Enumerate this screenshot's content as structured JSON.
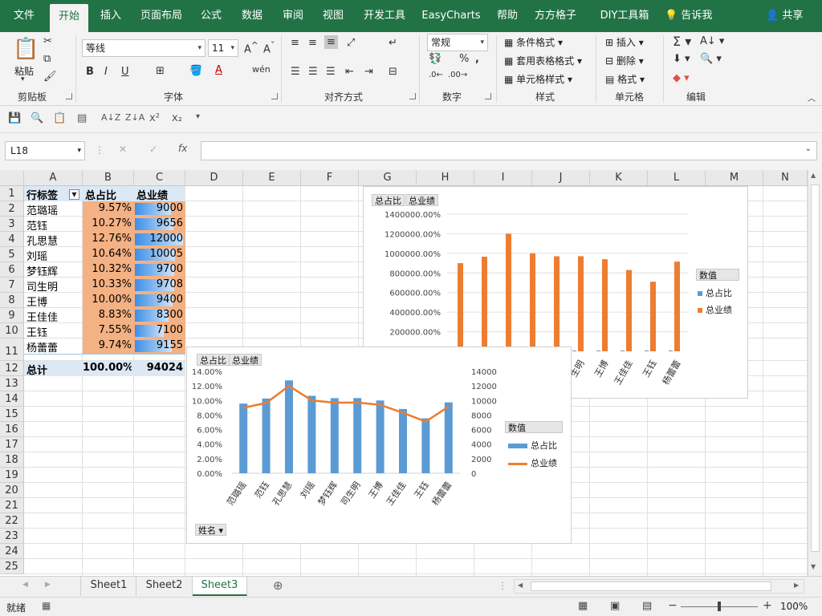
{
  "ribbon": {
    "tabs": [
      "文件",
      "开始",
      "插入",
      "页面布局",
      "公式",
      "数据",
      "审阅",
      "视图",
      "开发工具",
      "EasyCharts",
      "帮助",
      "方方格子",
      "DIY工具箱"
    ],
    "active_tab": "开始",
    "tell_me": "告诉我",
    "share": "共享",
    "clipboard": {
      "paste": "粘贴",
      "label": "剪贴板"
    },
    "font": {
      "name": "等线",
      "size": "11",
      "label": "字体"
    },
    "alignment": {
      "label": "对齐方式"
    },
    "number": {
      "format": "常规",
      "label": "数字"
    },
    "styles": {
      "conditional": "条件格式",
      "table": "套用表格格式",
      "cell": "单元格样式",
      "label": "样式"
    },
    "cells": {
      "insert": "插入",
      "delete": "删除",
      "format": "格式",
      "label": "单元格"
    },
    "editing": {
      "label": "编辑"
    }
  },
  "formula_bar": {
    "name_box": "L18",
    "formula": ""
  },
  "columns": [
    "A",
    "B",
    "C",
    "D",
    "E",
    "F",
    "G",
    "H",
    "I",
    "J",
    "K",
    "L",
    "M",
    "N"
  ],
  "rows": [
    "1",
    "2",
    "3",
    "4",
    "5",
    "6",
    "7",
    "8",
    "9",
    "10",
    "11",
    "12",
    "13",
    "14",
    "15",
    "16",
    "17",
    "18",
    "19",
    "20",
    "21",
    "22",
    "23",
    "24",
    "25"
  ],
  "table": {
    "headers": [
      "行标签",
      "总占比",
      "总业绩"
    ],
    "names": [
      "范璐瑶",
      "范钰",
      "孔思慧",
      "刘瑶",
      "梦钰辉",
      "司生明",
      "王博",
      "王佳佳",
      "王钰",
      "杨蕾蕾"
    ],
    "ratios": [
      "9.57%",
      "10.27%",
      "12.76%",
      "10.64%",
      "10.32%",
      "10.33%",
      "10.00%",
      "8.83%",
      "7.55%",
      "9.74%"
    ],
    "sales": [
      9000,
      9656,
      12000,
      10005,
      9700,
      9708,
      9400,
      8300,
      7100,
      9155
    ],
    "total_label": "总计",
    "total_ratio": "100.00%",
    "total_sales": "94024"
  },
  "colors": {
    "accent": "#217346",
    "orange_fill": "#f4b183",
    "header_fill": "#dde8f5",
    "bar_blue": "#5b9bd5",
    "line_orange": "#ed7d31"
  },
  "chart1": {
    "field_buttons": [
      "总占比",
      "总业绩"
    ],
    "legend_title": "数值",
    "legend": [
      "总占比",
      "总业绩"
    ],
    "y_ticks": [
      "1400000.00%",
      "1200000.00%",
      "1000000.00%",
      "800000.00%",
      "600000.00%",
      "400000.00%",
      "200000.00%"
    ],
    "visible_categories": [
      "生明",
      "王博",
      "王佳佳",
      "王钰",
      "杨蕾蕾"
    ]
  },
  "chart2": {
    "field_buttons": [
      "总占比",
      "总业绩"
    ],
    "legend_title": "数值",
    "legend": [
      "总占比",
      "总业绩"
    ],
    "axis_field": "姓名",
    "y_left_ticks": [
      "14.00%",
      "12.00%",
      "10.00%",
      "8.00%",
      "6.00%",
      "4.00%",
      "2.00%",
      "0.00%"
    ],
    "y_right_ticks": [
      "14000",
      "12000",
      "10000",
      "8000",
      "6000",
      "4000",
      "2000",
      "0"
    ]
  },
  "chart_data": [
    {
      "type": "bar",
      "categories": [
        "范璐瑶",
        "范钰",
        "孔思慧",
        "刘瑶",
        "梦钰辉",
        "司生明",
        "王博",
        "王佳佳",
        "王钰",
        "杨蕾蕾"
      ],
      "series": [
        {
          "name": "总占比",
          "values": [
            0.0957,
            0.1027,
            0.1276,
            0.1064,
            0.1032,
            0.1033,
            0.1,
            0.0883,
            0.0755,
            0.0974
          ]
        },
        {
          "name": "总业绩",
          "values": [
            9000,
            9656,
            12000,
            10005,
            9700,
            9708,
            9400,
            8300,
            7100,
            9155
          ]
        }
      ],
      "ylim": [
        0,
        1400000
      ],
      "legend": "right"
    },
    {
      "type": "bar",
      "categories": [
        "范璐瑶",
        "范钰",
        "孔思慧",
        "刘瑶",
        "梦钰辉",
        "司生明",
        "王博",
        "王佳佳",
        "王钰",
        "杨蕾蕾"
      ],
      "series": [
        {
          "name": "总占比",
          "type": "bar",
          "values": [
            9.57,
            10.27,
            12.76,
            10.64,
            10.32,
            10.33,
            10.0,
            8.83,
            7.55,
            9.74
          ]
        },
        {
          "name": "总业绩",
          "type": "line",
          "values": [
            9000,
            9656,
            12000,
            10005,
            9700,
            9708,
            9400,
            8300,
            7100,
            9155
          ]
        }
      ],
      "ylim": [
        0,
        14
      ],
      "y2lim": [
        0,
        14000
      ],
      "legend": "right"
    }
  ],
  "sheets": [
    "Sheet1",
    "Sheet2",
    "Sheet3"
  ],
  "active_sheet": "Sheet3",
  "status": {
    "ready": "就绪",
    "zoom": "100%"
  }
}
